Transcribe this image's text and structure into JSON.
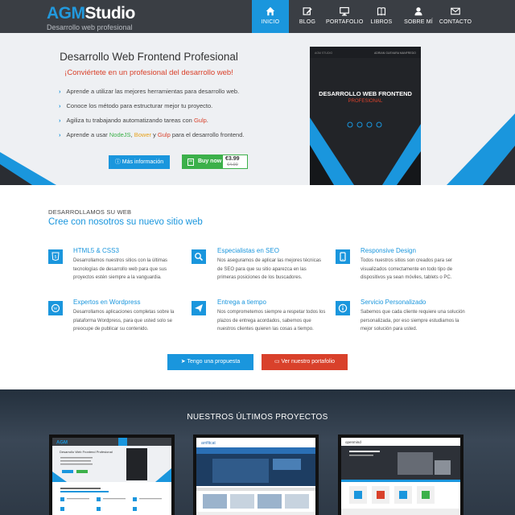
{
  "brand": {
    "logo_a": "AGM",
    "logo_b": "Studio",
    "tagline": "Desarrollo web profesional"
  },
  "nav": {
    "items": [
      {
        "label": "INICIO",
        "icon": "home-icon",
        "active": true
      },
      {
        "label": "BLOG",
        "icon": "edit-icon",
        "active": false
      },
      {
        "label": "PORTAFOLIO",
        "icon": "monitor-icon",
        "active": false
      },
      {
        "label": "LIBROS",
        "icon": "book-icon",
        "active": false
      },
      {
        "label": "SOBRE MÍ",
        "icon": "user-icon",
        "active": false
      },
      {
        "label": "CONTACTO",
        "icon": "mail-icon",
        "active": false
      }
    ]
  },
  "hero": {
    "title": "Desarrollo Web Frontend Profesional",
    "subtitle": "¡Conviértete en un profesional del desarrollo web!",
    "features": [
      {
        "text": "Aprende a utilizar las mejores herramientas para desarrollo web."
      },
      {
        "text": "Conoce los método para estructurar mejor tu proyecto."
      },
      {
        "pre": "Agiliza tu trabajando automatizando tareas con ",
        "hl": "Gulp",
        "post": "."
      },
      {
        "pre": "Aprende a usar ",
        "h1": "NodeJS",
        "sep1": ", ",
        "h2": "Bower",
        "sep2": " y ",
        "h3": "Gulp",
        "post": " para el desarrollo frontend."
      }
    ],
    "info_button": "Más información",
    "buy_button": "Buy now",
    "price": "€3.99",
    "old_price": "€4.99",
    "book": {
      "author": "ADRIAN GUEVARA MANFREDO",
      "title": "DESARROLLO WEB FRONTEND",
      "subtitle": "PROFESIONAL"
    }
  },
  "services": {
    "pretitle": "DESARROLLAMOS SU WEB",
    "title": "Cree con nosotros su nuevo sitio web",
    "items": [
      {
        "title": "HTML5 & CSS3",
        "desc": "Desarrollamos nuestros sitios con la últimas tecnologías de desarrollo web para que sus proyectos estén siempre a la vanguardia.",
        "icon": "html5-icon"
      },
      {
        "title": "Especialistas en SEO",
        "desc": "Nos aseguramos de aplicar las mejores técnicas de SEO para que su sitio aparezca en las primeras posiciones de los buscadores.",
        "icon": "search-icon"
      },
      {
        "title": "Responsive Design",
        "desc": "Todos nuestros sitios son creados para ser visualizados correctamente en todo tipo de dispositivos ya sean móviles, tablets o PC.",
        "icon": "tablet-icon"
      },
      {
        "title": "Expertos en Wordpress",
        "desc": "Desarrollamos aplicaciones completas sobre la plataforma Wordpress, para que usted solo se preocupe de publicar su contenido.",
        "icon": "wordpress-icon"
      },
      {
        "title": "Entrega a tiempo",
        "desc": "Nos comprometemos siempre a respetar todos los plazos de entrega acordados, sabemos que nuestros clientes quieren las cosas a tiempo.",
        "icon": "paper-plane-icon"
      },
      {
        "title": "Servicio Personalizado",
        "desc": "Sabemos que cada cliente requiere una solución personalizada, por eso siempre estudiamos la mejor solución para usted.",
        "icon": "info-icon"
      }
    ],
    "btn_proposal": "Tengo una propuesta",
    "btn_portfolio": "Ver nuestro portafolio"
  },
  "projects": {
    "title": "NUESTROS ÚLTIMOS PROYECTOS",
    "thumb1": {
      "logo_a": "AGM",
      "logo_b": "Studio",
      "title": "Desarrollo Web Frontend Profesional"
    },
    "thumb2": {
      "logo": "arrifitcat",
      "banner": "Therabody for Rosenberg"
    },
    "thumb3": {
      "logo": "openmind",
      "headline": "¡Solución para su negocio!"
    }
  },
  "colors": {
    "accent": "#1a96dd",
    "red": "#d9412b",
    "green": "#3cb04a",
    "nav_bg": "#3a3e44"
  }
}
